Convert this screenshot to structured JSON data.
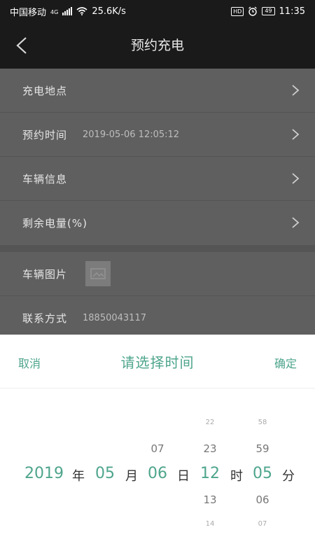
{
  "status_bar": {
    "carrier": "中国移动",
    "network": "4G",
    "speed": "25.6K/s",
    "hd": "HD",
    "battery": "49",
    "time": "11:35"
  },
  "header": {
    "title": "预约充电"
  },
  "form": {
    "rows": [
      {
        "label": "充电地点",
        "value": ""
      },
      {
        "label": "预约时间",
        "value": "2019-05-06 12:05:12"
      },
      {
        "label": "车辆信息",
        "value": ""
      },
      {
        "label": "剩余电量(%)",
        "value": ""
      }
    ],
    "vehicle_image_label": "车辆图片",
    "contact": {
      "label": "联系方式",
      "value": "18850043117"
    }
  },
  "picker": {
    "cancel": "取消",
    "title": "请选择时间",
    "confirm": "确定",
    "year": {
      "selected": "2019",
      "unit": "年"
    },
    "month": {
      "selected": "05",
      "unit": "月"
    },
    "day": {
      "above1": "07",
      "selected": "06",
      "unit": "日"
    },
    "hour": {
      "above2": "22",
      "above1": "23",
      "selected": "12",
      "below1": "13",
      "below2": "14",
      "unit": "时"
    },
    "minute": {
      "above2": "58",
      "above1": "59",
      "selected": "05",
      "below1": "06",
      "below2": "07",
      "unit": "分"
    }
  },
  "colors": {
    "accent": "#4ea58c",
    "titlebar": "#1a1a1a",
    "overlay_row": "#5f5f5f"
  }
}
